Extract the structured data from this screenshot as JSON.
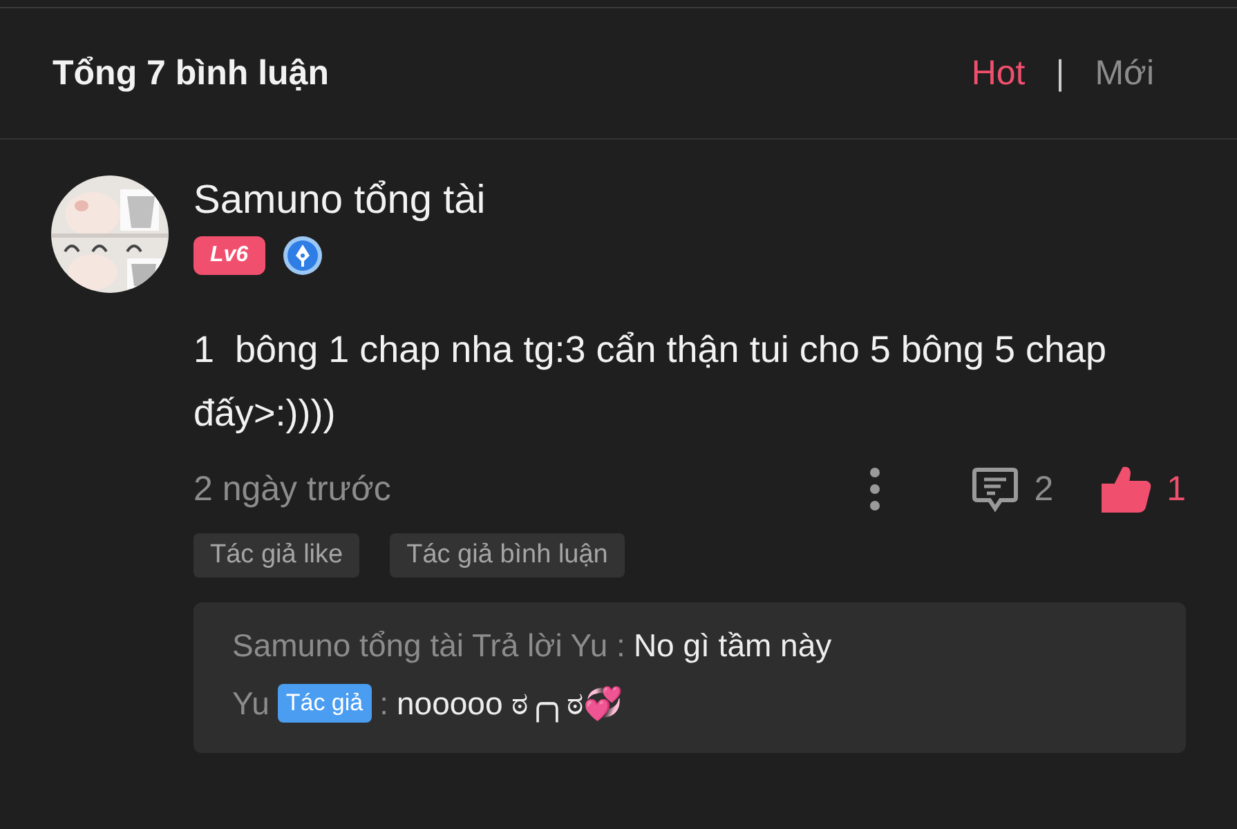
{
  "header": {
    "title": "Tổng 7 bình luận",
    "sort_tabs": [
      {
        "label": "Hot",
        "selected": true
      },
      {
        "label": "Mới",
        "selected": false
      }
    ],
    "separator": "|"
  },
  "comment": {
    "author": "Samuno tổng tài",
    "level_badge": "Lv6",
    "text": "1  bông 1 chap nha tg:3 cẩn thận tui cho 5 bông 5 chap đấy>:))))",
    "time": "2 ngày trước",
    "reply_count": "2",
    "like_count": "1",
    "liked": true,
    "tags": [
      "Tác giả like",
      "Tác giả bình luận"
    ],
    "replies": [
      {
        "kind": "reply",
        "prefix": "Samuno tổng tài Trả lời Yu :",
        "text": "No gì tầm này"
      },
      {
        "kind": "author",
        "prefix": "Yu",
        "badge": "Tác giả",
        "separator": ":",
        "text": "nooooo ಠ╭╮ಠ💞"
      }
    ]
  }
}
